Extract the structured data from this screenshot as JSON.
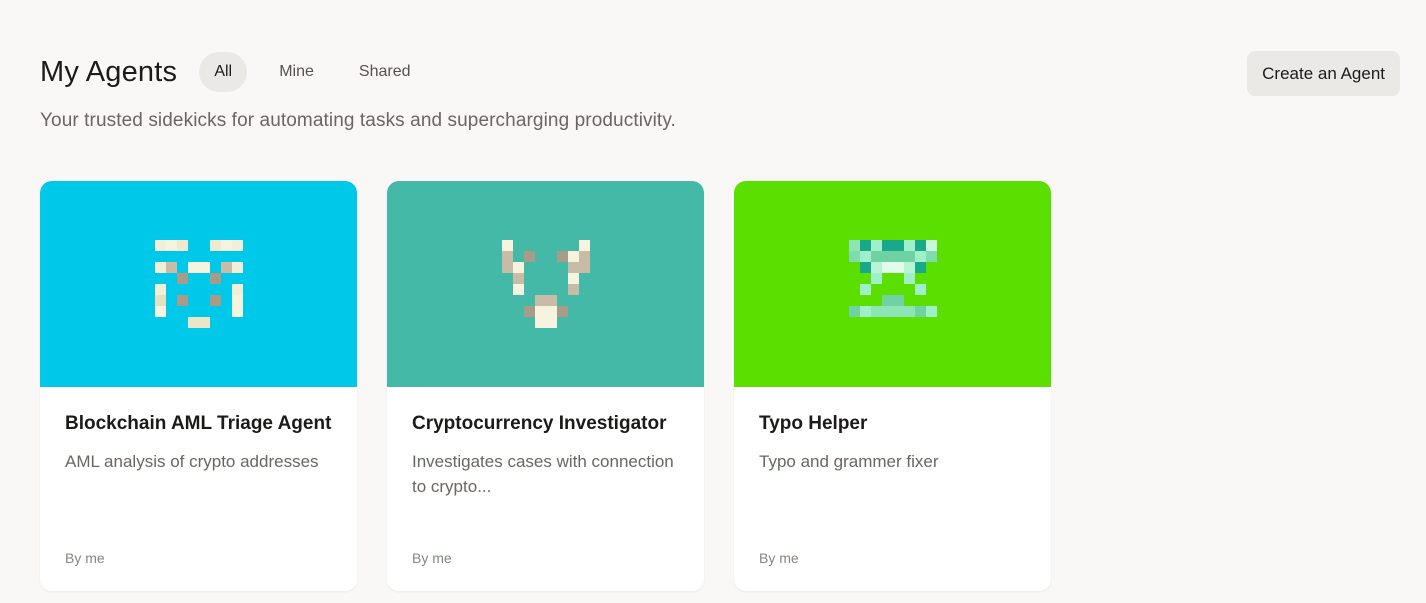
{
  "header": {
    "title": "My Agents",
    "tabs": [
      {
        "label": "All",
        "active": true
      },
      {
        "label": "Mine",
        "active": false
      },
      {
        "label": "Shared",
        "active": false
      }
    ],
    "subtitle": "Your trusted sidekicks for automating tasks and supercharging productivity.",
    "create_label": "Create an Agent"
  },
  "agents": [
    {
      "title": "Blockchain AML Triage Agent",
      "description": "AML analysis of crypto addresses",
      "author": "By me",
      "banner_color": "#00c8e8",
      "icon": "pixel-avatar-icon"
    },
    {
      "title": "Cryptocurrency Investigator",
      "description": "Investigates cases with connection to crypto...",
      "author": "By me",
      "banner_color": "#44b9a7",
      "icon": "pixel-avatar-icon"
    },
    {
      "title": "Typo Helper",
      "description": "Typo and grammer fixer",
      "author": "By me",
      "banner_color": "#5adf00",
      "icon": "pixel-avatar-icon"
    }
  ]
}
